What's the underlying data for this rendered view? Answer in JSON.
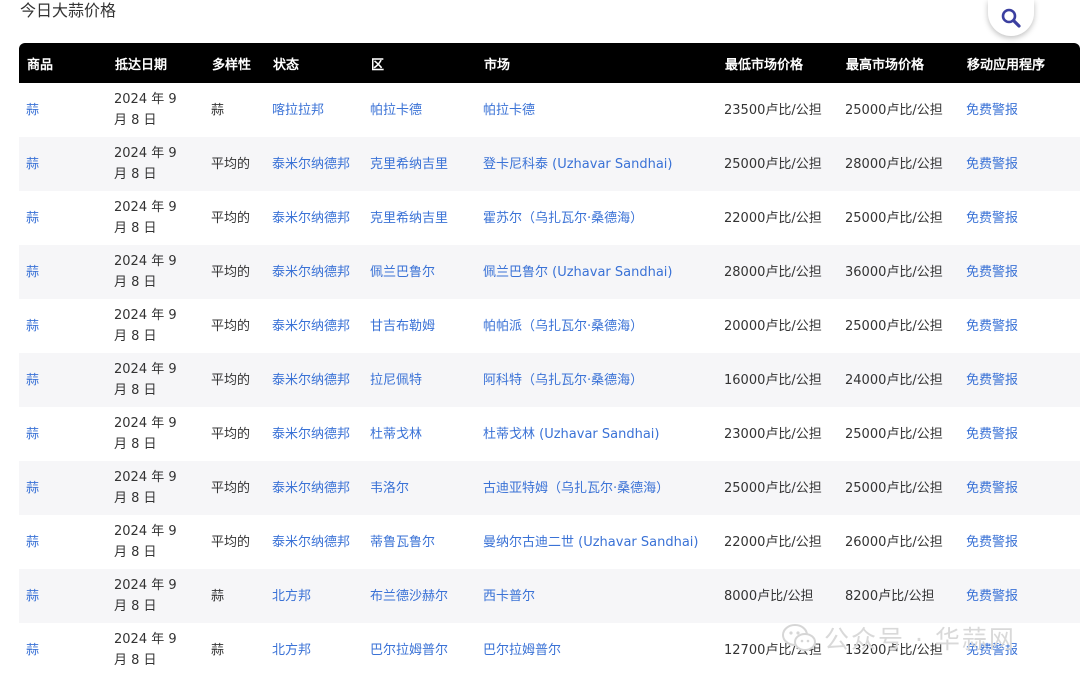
{
  "page": {
    "title": "今日大蒜价格",
    "search_icon": "search-icon",
    "accent_color": "#3a72d6",
    "header_bg": "#000000",
    "stripe_bg": "#f6f6f8"
  },
  "table": {
    "columns": [
      "商品",
      "抵达日期",
      "多样性",
      "状态",
      "区",
      "市场",
      "最低市场价格",
      "最高市场价格",
      "移动应用程序"
    ],
    "rows": [
      {
        "commodity": "蒜",
        "date": "2024 年 9 月 8 日",
        "variety": "蒜",
        "state": "喀拉拉邦",
        "district": "帕拉卡德",
        "market": "帕拉卡德",
        "min_price": "23500卢比/公担",
        "max_price": "25000卢比/公担",
        "app": "免费警报"
      },
      {
        "commodity": "蒜",
        "date": "2024 年 9 月 8 日",
        "variety": "平均的",
        "state": "泰米尔纳德邦",
        "district": "克里希纳吉里",
        "market": "登卡尼科泰 (Uzhavar Sandhai)",
        "min_price": "25000卢比/公担",
        "max_price": "28000卢比/公担",
        "app": "免费警报"
      },
      {
        "commodity": "蒜",
        "date": "2024 年 9 月 8 日",
        "variety": "平均的",
        "state": "泰米尔纳德邦",
        "district": "克里希纳吉里",
        "market": "霍苏尔（乌扎瓦尔·桑德海）",
        "min_price": "22000卢比/公担",
        "max_price": "25000卢比/公担",
        "app": "免费警报"
      },
      {
        "commodity": "蒜",
        "date": "2024 年 9 月 8 日",
        "variety": "平均的",
        "state": "泰米尔纳德邦",
        "district": "佩兰巴鲁尔",
        "market": "佩兰巴鲁尔 (Uzhavar Sandhai)",
        "min_price": "28000卢比/公担",
        "max_price": "36000卢比/公担",
        "app": "免费警报"
      },
      {
        "commodity": "蒜",
        "date": "2024 年 9 月 8 日",
        "variety": "平均的",
        "state": "泰米尔纳德邦",
        "district": "甘吉布勒姆",
        "market": "帕帕派（乌扎瓦尔·桑德海）",
        "min_price": "20000卢比/公担",
        "max_price": "25000卢比/公担",
        "app": "免费警报"
      },
      {
        "commodity": "蒜",
        "date": "2024 年 9 月 8 日",
        "variety": "平均的",
        "state": "泰米尔纳德邦",
        "district": "拉尼佩特",
        "market": "阿科特（乌扎瓦尔·桑德海）",
        "min_price": "16000卢比/公担",
        "max_price": "24000卢比/公担",
        "app": "免费警报"
      },
      {
        "commodity": "蒜",
        "date": "2024 年 9 月 8 日",
        "variety": "平均的",
        "state": "泰米尔纳德邦",
        "district": "杜蒂戈林",
        "market": "杜蒂戈林 (Uzhavar Sandhai)",
        "min_price": "23000卢比/公担",
        "max_price": "25000卢比/公担",
        "app": "免费警报"
      },
      {
        "commodity": "蒜",
        "date": "2024 年 9 月 8 日",
        "variety": "平均的",
        "state": "泰米尔纳德邦",
        "district": "韦洛尔",
        "market": "古迪亚特姆（乌扎瓦尔·桑德海）",
        "min_price": "25000卢比/公担",
        "max_price": "25000卢比/公担",
        "app": "免费警报"
      },
      {
        "commodity": "蒜",
        "date": "2024 年 9 月 8 日",
        "variety": "平均的",
        "state": "泰米尔纳德邦",
        "district": "蒂鲁瓦鲁尔",
        "market": "曼纳尔古迪二世 (Uzhavar Sandhai)",
        "min_price": "22000卢比/公担",
        "max_price": "26000卢比/公担",
        "app": "免费警报"
      },
      {
        "commodity": "蒜",
        "date": "2024 年 9 月 8 日",
        "variety": "蒜",
        "state": "北方邦",
        "district": "布兰德沙赫尔",
        "market": "西卡普尔",
        "min_price": "8000卢比/公担",
        "max_price": "8200卢比/公担",
        "app": "免费警报"
      },
      {
        "commodity": "蒜",
        "date": "2024 年 9 月 8 日",
        "variety": "蒜",
        "state": "北方邦",
        "district": "巴尔拉姆普尔",
        "market": "巴尔拉姆普尔",
        "min_price": "12700卢比/公担",
        "max_price": "13200卢比/公担",
        "app": "免费警报"
      }
    ]
  },
  "watermark": {
    "text": "公众号 · 华蒜网",
    "icon": "wechat-icon"
  }
}
